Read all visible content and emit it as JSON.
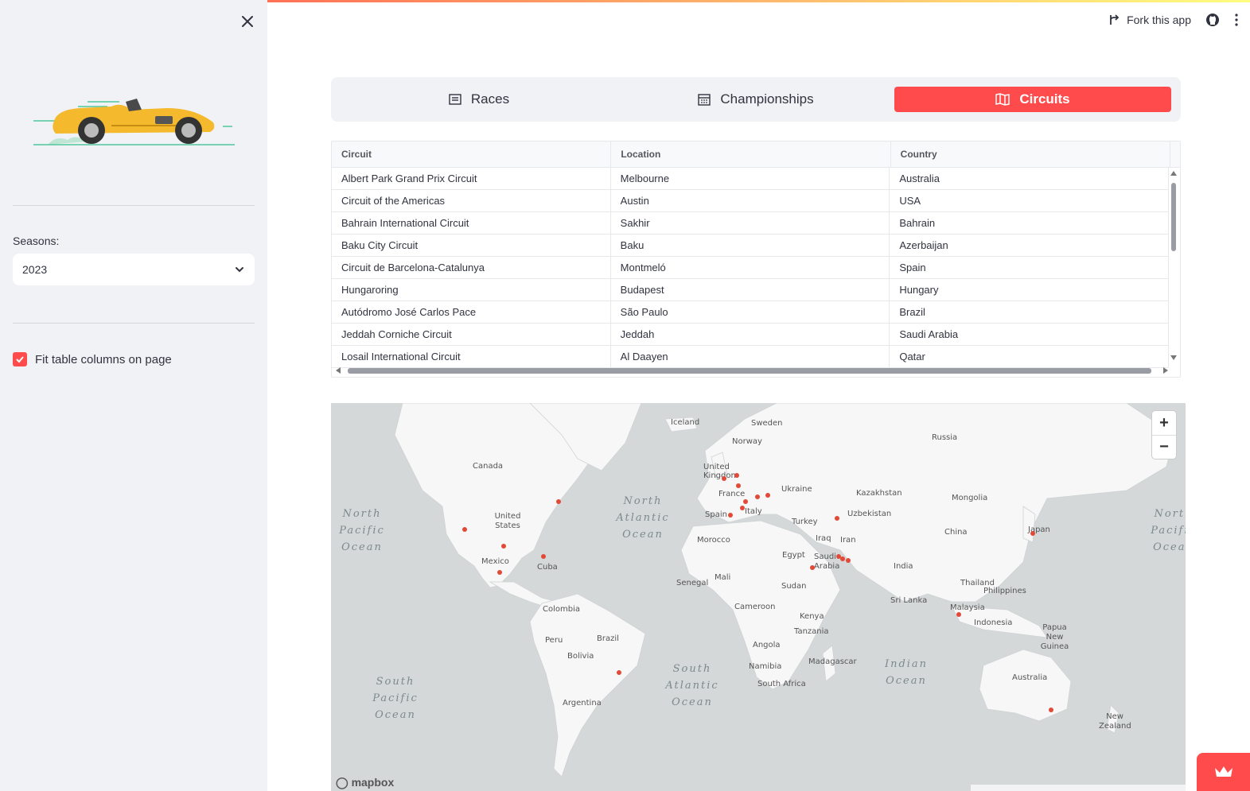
{
  "header": {
    "fork_label": "Fork this app"
  },
  "sidebar": {
    "seasons_label": "Seasons:",
    "season_value": "2023",
    "fit_columns_label": "Fit table columns on page"
  },
  "tabs": [
    {
      "label": "Races"
    },
    {
      "label": "Championships"
    },
    {
      "label": "Circuits"
    }
  ],
  "table": {
    "columns": [
      "Circuit",
      "Location",
      "Country"
    ],
    "rows": [
      [
        "Albert Park Grand Prix Circuit",
        "Melbourne",
        "Australia"
      ],
      [
        "Circuit of the Americas",
        "Austin",
        "USA"
      ],
      [
        "Bahrain International Circuit",
        "Sakhir",
        "Bahrain"
      ],
      [
        "Baku City Circuit",
        "Baku",
        "Azerbaijan"
      ],
      [
        "Circuit de Barcelona-Catalunya",
        "Montmeló",
        "Spain"
      ],
      [
        "Hungaroring",
        "Budapest",
        "Hungary"
      ],
      [
        "Autódromo José Carlos Pace",
        "São Paulo",
        "Brazil"
      ],
      [
        "Jeddah Corniche Circuit",
        "Jeddah",
        "Saudi Arabia"
      ],
      [
        "Losail International Circuit",
        "Al Daayen",
        "Qatar"
      ]
    ]
  },
  "map": {
    "countries": [
      "Iceland",
      "Sweden",
      "Norway",
      "Russia",
      "Canada",
      "United Kingdom",
      "Ukraine",
      "Kazakhstan",
      "Mongolia",
      "France",
      "Uzbekistan",
      "United States",
      "Spain",
      "Italy",
      "Turkey",
      "China",
      "Japan",
      "Morocco",
      "Iraq",
      "Iran",
      "Mexico",
      "Egypt",
      "Saudi Arabia",
      "Cuba",
      "India",
      "Mali",
      "Senegal",
      "Thailand",
      "Philippines",
      "Sudan",
      "Sri Lanka",
      "Colombia",
      "Cameroon",
      "Malaysia",
      "Kenya",
      "Indonesia",
      "Papua New Guinea",
      "Peru",
      "Brazil",
      "Tanzania",
      "Bolivia",
      "Angola",
      "Madagascar",
      "Namibia",
      "Australia",
      "South Africa",
      "Argentina",
      "New Zealand"
    ],
    "oceans": [
      "North Pacific Ocean",
      "North Atlantic Ocean",
      "North Pacific Ocean",
      "South Atlantic Ocean",
      "Indian Ocean",
      "South Pacific Ocean"
    ],
    "zoom_in": "+",
    "zoom_out": "−",
    "logo": "mapbox"
  }
}
